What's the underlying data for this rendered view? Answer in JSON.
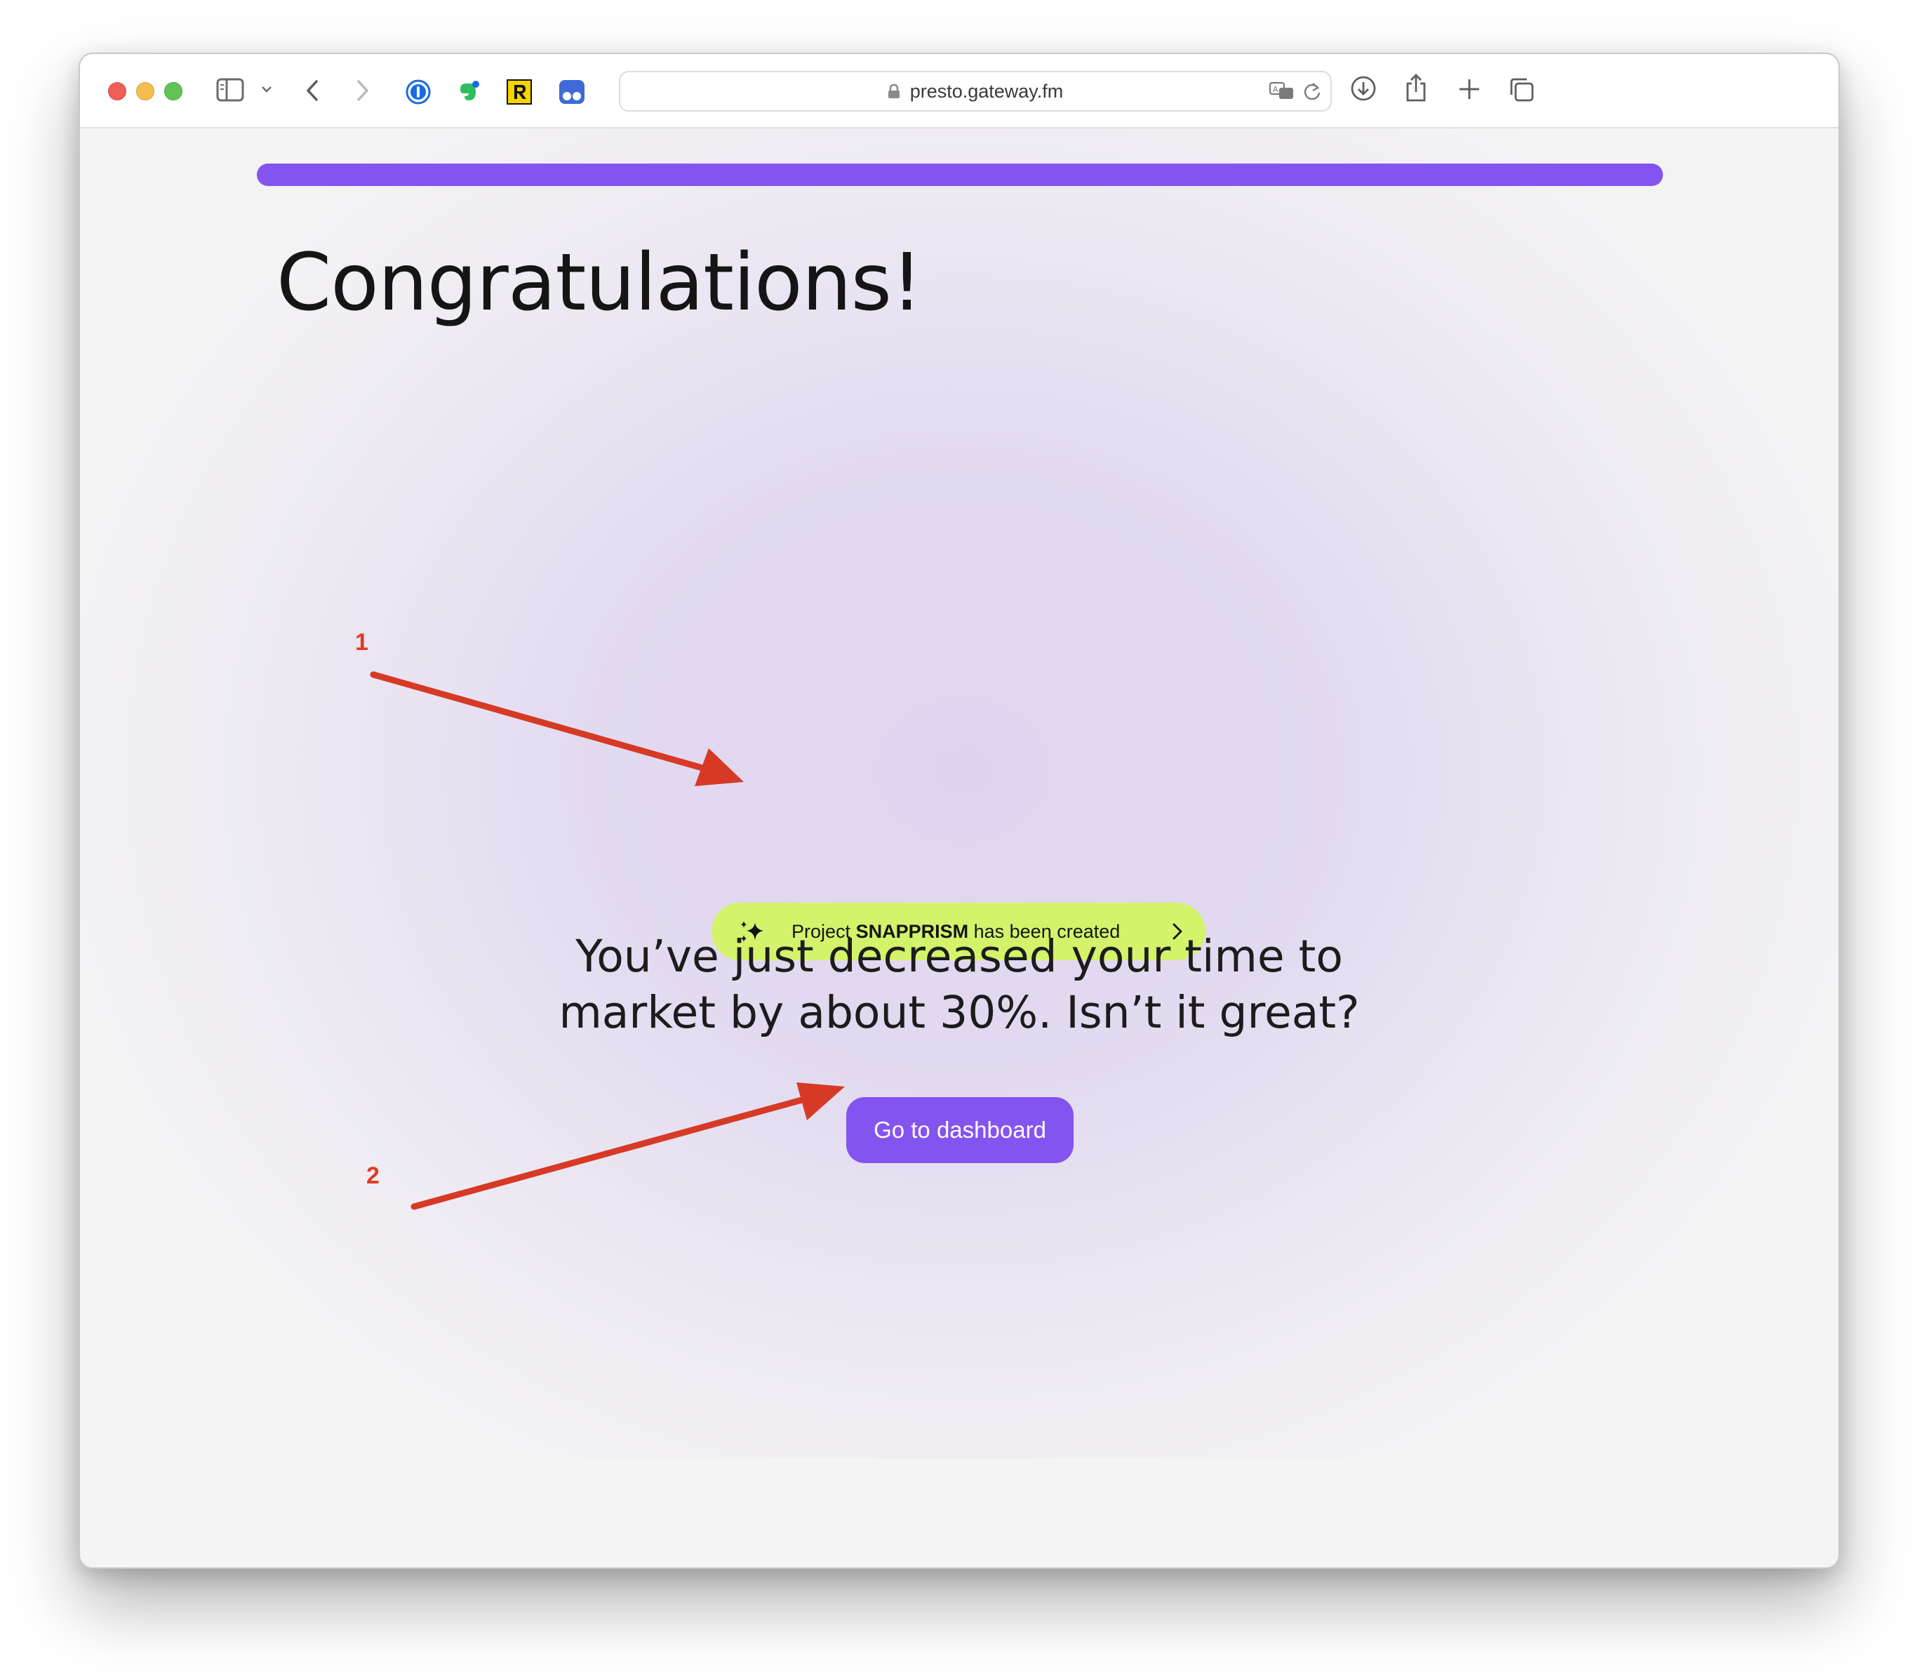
{
  "browser": {
    "url": "presto.gateway.fm",
    "extensions": [
      "1password-icon",
      "evernote-icon",
      "readwise-reader-icon",
      "tab-manager-icon"
    ]
  },
  "page": {
    "title": "Congratulations!",
    "notice": {
      "prefix": "Project",
      "project_name": "SNAPPRISM",
      "suffix": "has been created"
    },
    "message_line1": "You’ve just decreased your time to",
    "message_line2": "market by about 30%. Isn’t it great?",
    "cta_label": "Go to dashboard",
    "progress": 1.0
  },
  "annotations": {
    "callout1": "1",
    "callout2": "2"
  },
  "colors": {
    "accent": "#8454f0",
    "notice_bg": "#d3f36b",
    "annotation": "#e03b23"
  }
}
